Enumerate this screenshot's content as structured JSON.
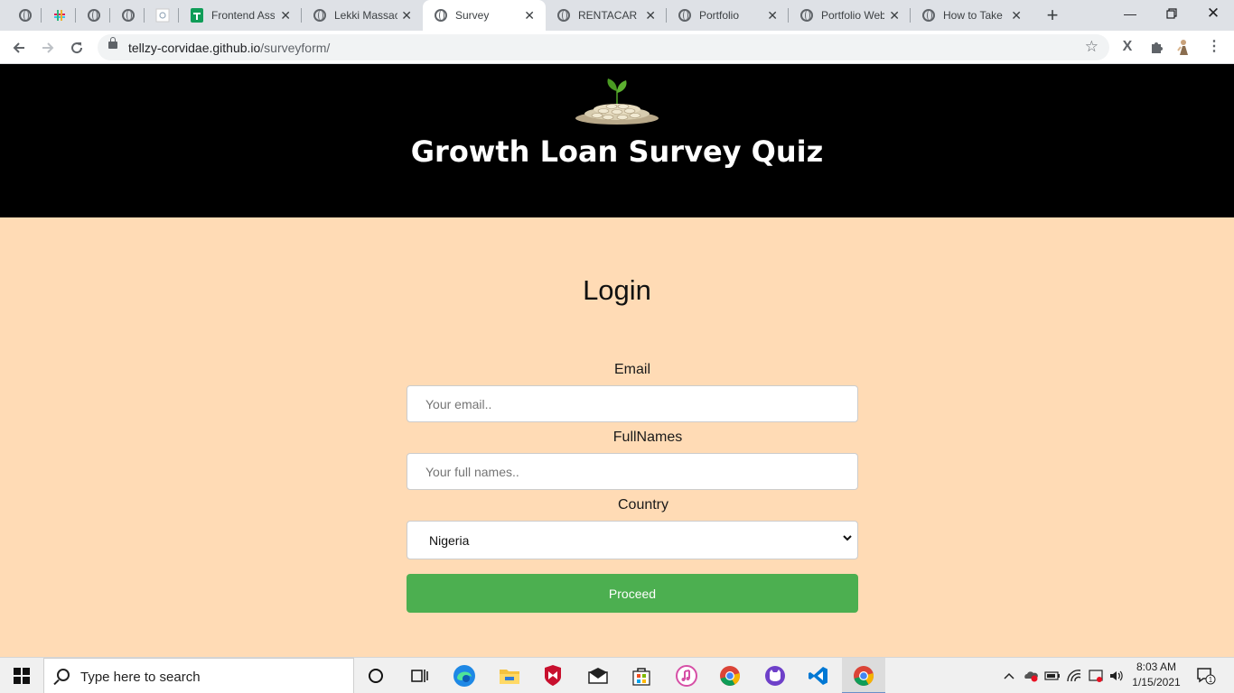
{
  "browser": {
    "tabs": [
      {
        "title": "",
        "icon": "globe-icon"
      },
      {
        "title": "",
        "icon": "slack-icon"
      },
      {
        "title": "",
        "icon": "globe-icon"
      },
      {
        "title": "",
        "icon": "globe-icon"
      },
      {
        "title": "",
        "icon": "blank-page-icon"
      },
      {
        "title": "Frontend Ass",
        "icon": "sheets-icon"
      },
      {
        "title": "Lekki Massac",
        "icon": "globe-icon"
      },
      {
        "title": "Survey",
        "icon": "globe-icon",
        "active": true
      },
      {
        "title": "RENTACAR",
        "icon": "globe-icon"
      },
      {
        "title": "Portfolio",
        "icon": "globe-icon"
      },
      {
        "title": "Portfolio Web",
        "icon": "globe-icon"
      },
      {
        "title": "How to Take",
        "icon": "globe-icon"
      }
    ],
    "url_host": "tellzy-corvidae.github.io",
    "url_path": "/surveyform/",
    "accent": "#4caf50"
  },
  "page": {
    "title": "Growth Loan Survey Quiz",
    "login_heading": "Login",
    "email_label": "Email",
    "email_placeholder": "Your email..",
    "fullnames_label": "FullNames",
    "fullnames_placeholder": "Your full names..",
    "country_label": "Country",
    "country_selected": "Nigeria",
    "proceed_label": "Proceed"
  },
  "taskbar": {
    "search_placeholder": "Type here to search",
    "time": "8:03 AM",
    "date": "1/15/2021",
    "notification_count": "1"
  }
}
